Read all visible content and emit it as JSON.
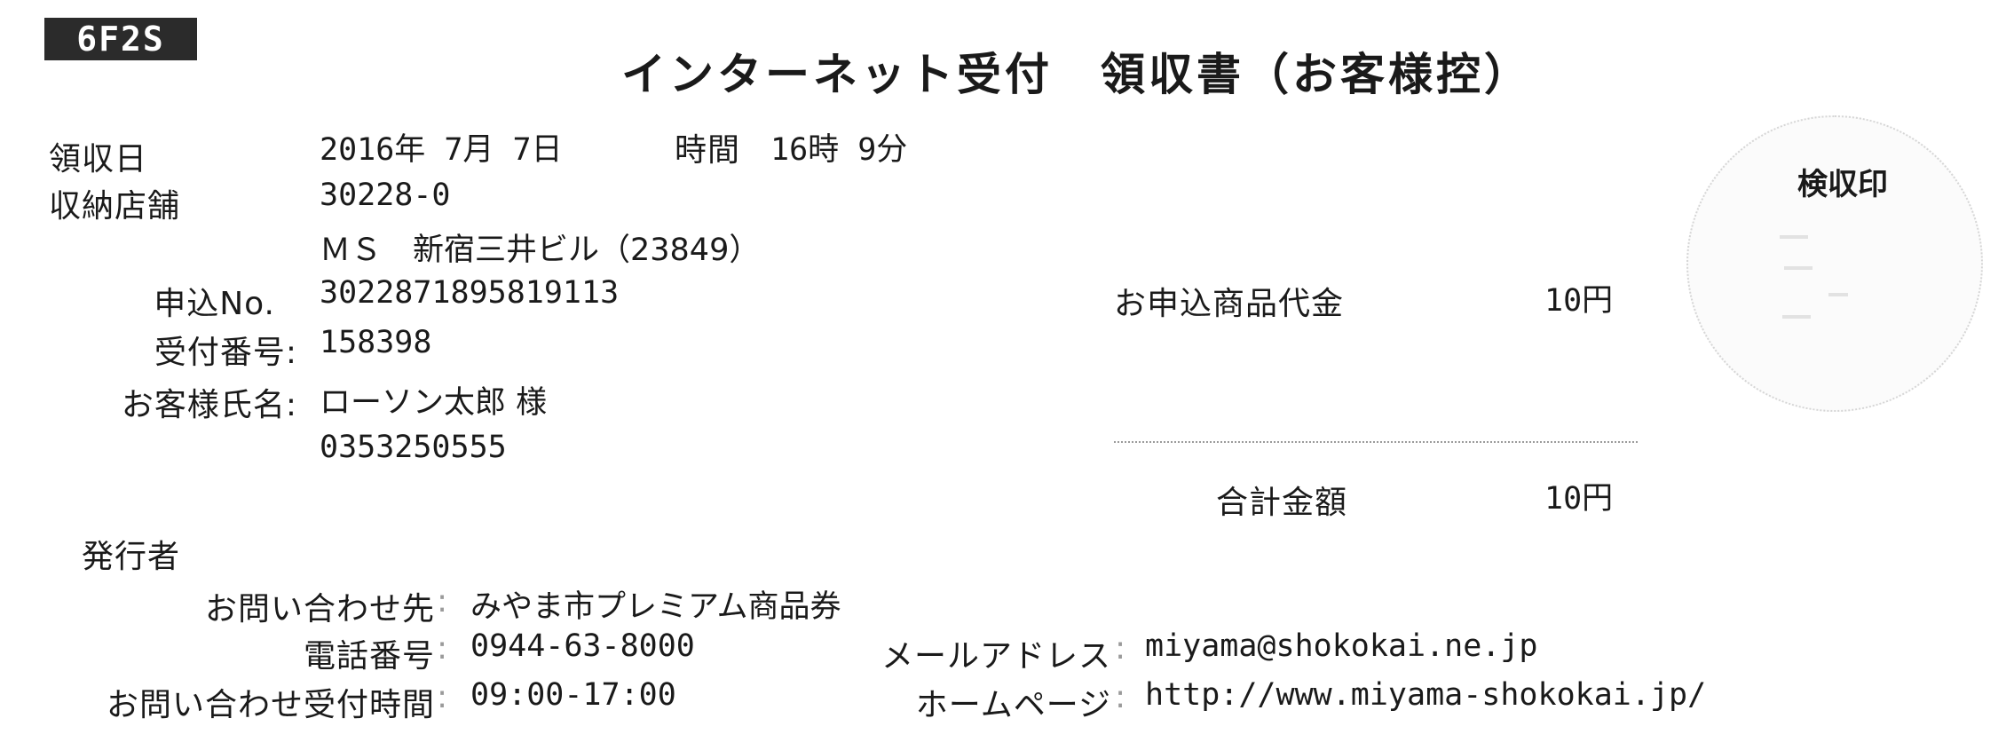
{
  "receipt": {
    "code_badge": "6F2S",
    "title": "インターネット受付　領収書（お客様控）"
  },
  "details": {
    "date_label": "領収日",
    "date_value": "2016年 7月 7日",
    "time_label": "時間",
    "time_value": "16時 9分",
    "store_label": "収納店舗",
    "store_code": "30228-0",
    "store_name": "ＭＳ　新宿三井ビル（23849）",
    "application_no_label": "申込No.",
    "application_no": "3022871895819113",
    "reception_no_label": "受付番号:",
    "reception_no": "158398",
    "customer_name_label": "お客様氏名:",
    "customer_name": "ローソン太郎 様",
    "customer_phone": "0353250555"
  },
  "amounts": {
    "product_price_label": "お申込商品代金",
    "product_price_value": "10円",
    "total_label": "合計金額",
    "total_value": "10円"
  },
  "stamp": {
    "label": "検収印"
  },
  "issuer": {
    "heading": "発行者",
    "contact_label": "お問い合わせ先",
    "contact_value": "みやま市プレミアム商品券",
    "phone_label": "電話番号",
    "phone_value": "0944-63-8000",
    "email_label": "メールアドレス",
    "email_value": "miyama@shokokai.ne.jp",
    "hours_label": "お問い合わせ受付時間",
    "hours_value": "09:00-17:00",
    "homepage_label": "ホームページ",
    "homepage_value": "http://www.miyama-shokokai.jp/",
    "colon": ":"
  }
}
